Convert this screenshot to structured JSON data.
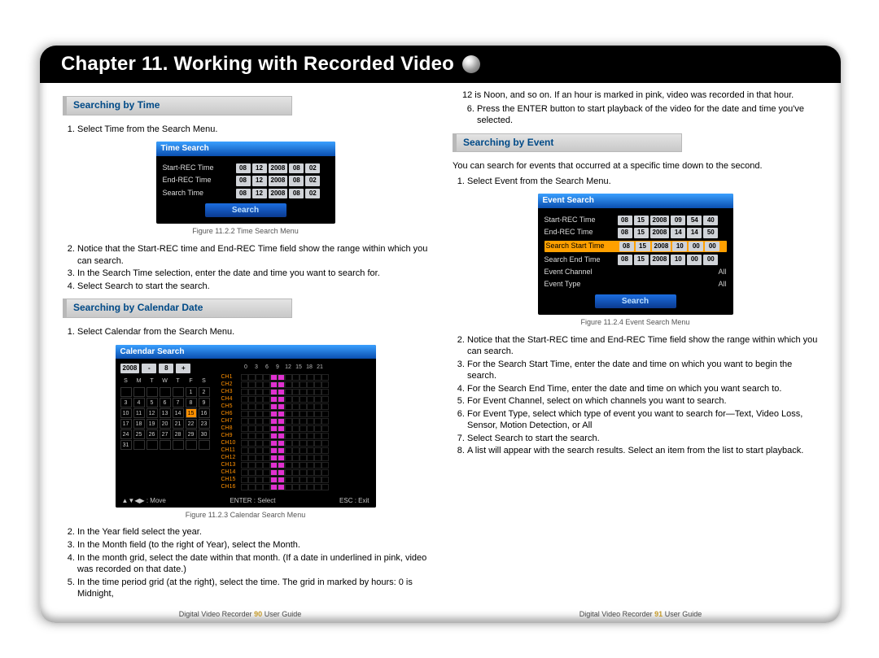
{
  "header": {
    "title": "Chapter 11. Working with Recorded Video"
  },
  "left": {
    "s1": {
      "heading": "Searching by Time",
      "steps": [
        "Select Time from the Search Menu.",
        "Notice that the Start-REC time and End-REC Time field show the range within which you can search.",
        "In the Search Time selection, enter the date and time you want to search for.",
        "Select Search to start the search."
      ],
      "fig": {
        "title": "Time Search",
        "rows": [
          {
            "label": "Start-REC Time",
            "v": [
              "08",
              "12",
              "2008",
              "08",
              "02"
            ]
          },
          {
            "label": "End-REC Time",
            "v": [
              "08",
              "12",
              "2008",
              "08",
              "02"
            ]
          },
          {
            "label": "Search Time",
            "v": [
              "08",
              "12",
              "2008",
              "08",
              "02"
            ]
          }
        ],
        "button": "Search"
      },
      "figcap": "Figure 11.2.2 Time Search Menu"
    },
    "s2": {
      "heading": "Searching by Calendar Date",
      "steps": [
        "Select Calendar from the Search Menu.",
        "In the Year field select the year.",
        "In the Month field (to the right of Year), select the Month.",
        "In the month grid, select the date within that month. (If a date in underlined in pink, video was recorded on that date.)",
        "In the time period grid (at the right), select the time. The grid in marked by hours: 0 is Midnight,"
      ],
      "fig": {
        "title": "Calendar Search",
        "year": "2008",
        "month": "8",
        "dow": [
          "S",
          "M",
          "T",
          "W",
          "T",
          "F",
          "S"
        ],
        "weeks": [
          [
            "",
            "",
            "",
            "",
            "",
            "1",
            "2"
          ],
          [
            "3",
            "4",
            "5",
            "6",
            "7",
            "8",
            "9"
          ],
          [
            "10",
            "11",
            "12",
            "13",
            "14",
            "15",
            "16"
          ],
          [
            "17",
            "18",
            "19",
            "20",
            "21",
            "22",
            "23"
          ],
          [
            "24",
            "25",
            "26",
            "27",
            "28",
            "29",
            "30"
          ],
          [
            "31",
            "",
            "",
            "",
            "",
            "",
            ""
          ]
        ],
        "pinkDates": [
          "15"
        ],
        "selDate": "15",
        "hours": [
          "0",
          "3",
          "6",
          "9",
          "12",
          "15",
          "18",
          "21"
        ],
        "channels": [
          "CH1",
          "CH2",
          "CH3",
          "CH4",
          "CH5",
          "CH6",
          "CH7",
          "CH8",
          "CH9",
          "CH10",
          "CH11",
          "CH12",
          "CH13",
          "CH14",
          "CH15",
          "CH16"
        ],
        "pinkCols": [
          4,
          5
        ],
        "footer": [
          "▲▼◀▶ : Move",
          "ENTER : Select",
          "ESC : Exit"
        ]
      },
      "figcap": "Figure 11.2.3 Calendar Search Menu"
    }
  },
  "right": {
    "cont": [
      "12 is Noon, and so on. If an hour is marked in pink, video was recorded in that hour.",
      "Press the ENTER button to start playback of the video for the date and time you've selected."
    ],
    "s1": {
      "heading": "Searching by Event",
      "intro": "You can search for events that occurred at a specific time down to the second.",
      "steps": [
        "Select Event from the Search Menu.",
        "Notice that the Start-REC time and End-REC Time field show the range within which you can search.",
        "For the Search Start Time, enter the date and time on which you want to begin the search.",
        "For the Search End Time, enter the date and time on which you want search to.",
        "For Event Channel, select on which channels you want to search.",
        "For Event Type, select which type of event you want to search for—Text, Video Loss, Sensor, Motion Detection, or All",
        "Select Search to start the search.",
        "A list will appear with the search results. Select an item from the list to start playback."
      ],
      "fig": {
        "title": "Event Search",
        "rows": [
          {
            "label": "Start-REC Time",
            "v": [
              "08",
              "15",
              "2008",
              "09",
              "54",
              "40"
            ]
          },
          {
            "label": "End-REC Time",
            "v": [
              "08",
              "15",
              "2008",
              "14",
              "14",
              "50"
            ]
          },
          {
            "label": "Search Start Time",
            "v": [
              "08",
              "15",
              "2008",
              "10",
              "00",
              "00"
            ]
          },
          {
            "label": "Search End Time",
            "v": [
              "08",
              "15",
              "2008",
              "10",
              "00",
              "00"
            ]
          },
          {
            "label": "Event Channel",
            "value": "All"
          },
          {
            "label": "Event Type",
            "value": "All"
          }
        ],
        "button": "Search"
      },
      "figcap": "Figure 11.2.4 Event Search Menu"
    }
  },
  "footer": {
    "left": {
      "a": "Digital Video Recorder",
      "page": "90",
      "b": "User Guide"
    },
    "right": {
      "a": "Digital Video Recorder",
      "page": "91",
      "b": "User Guide"
    }
  }
}
